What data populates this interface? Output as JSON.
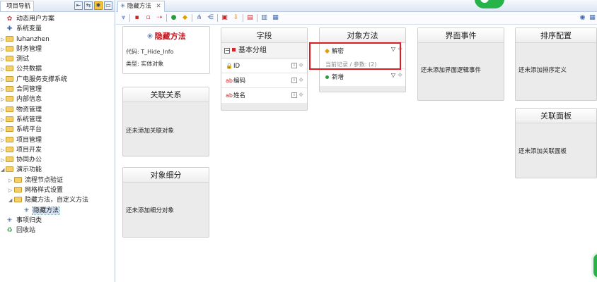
{
  "nav": {
    "tab_label": "项目导航",
    "items": [
      {
        "label": "动态用户方案",
        "icon": "special",
        "level": 0
      },
      {
        "label": "系统变量",
        "icon": "special",
        "level": 0
      },
      {
        "label": "luhanzhen",
        "icon": "folder",
        "level": 0
      },
      {
        "label": "财务管理",
        "icon": "folder",
        "level": 0
      },
      {
        "label": "测试",
        "icon": "folder",
        "level": 0
      },
      {
        "label": "公共数据",
        "icon": "folder",
        "level": 0
      },
      {
        "label": "广电服务支撑系统",
        "icon": "folder",
        "level": 0
      },
      {
        "label": "合同管理",
        "icon": "folder",
        "level": 0
      },
      {
        "label": "内部信息",
        "icon": "folder",
        "level": 0
      },
      {
        "label": "物资管理",
        "icon": "folder",
        "level": 0
      },
      {
        "label": "系统管理",
        "icon": "folder",
        "level": 0
      },
      {
        "label": "系统平台",
        "icon": "folder",
        "level": 0
      },
      {
        "label": "项目管理",
        "icon": "folder",
        "level": 0
      },
      {
        "label": "项目开发",
        "icon": "folder",
        "level": 0
      },
      {
        "label": "协同办公",
        "icon": "folder",
        "level": 0
      },
      {
        "label": "演示功能",
        "icon": "folder",
        "level": 0
      },
      {
        "label": "流程节点验证",
        "icon": "folder",
        "level": 1
      },
      {
        "label": "网格样式设置",
        "icon": "folder",
        "level": 1
      },
      {
        "label": "隐藏方法，自定义方法",
        "icon": "folder",
        "level": 1
      },
      {
        "label": "隐藏方法",
        "icon": "special",
        "level": 2
      },
      {
        "label": "事项归类",
        "icon": "special",
        "level": 0
      },
      {
        "label": "回收站",
        "icon": "special",
        "level": 0
      }
    ]
  },
  "editor": {
    "tab_label": "隐藏方法",
    "info": {
      "title": "隐藏方法",
      "code": "代码: T_Hide_Info",
      "type": "类型: 实体对象"
    },
    "related": {
      "title": "关联关系",
      "empty": "还未添加关联对象"
    },
    "subdivision": {
      "title": "对象细分",
      "empty": "还未添加细分对象"
    },
    "fields": {
      "title": "字段",
      "group": "基本分组",
      "rows": [
        "ID",
        "编码",
        "姓名"
      ]
    },
    "methods": {
      "title": "对象方法",
      "rows": [
        {
          "label": "解密",
          "sub": "当前记录 / 参数: (2)"
        },
        {
          "label": "新增",
          "sub": ""
        }
      ]
    },
    "ui_events": {
      "title": "界面事件",
      "empty": "还未添加界面逻辑事件"
    },
    "sort_config": {
      "title": "排序配置",
      "empty": "还未添加排序定义"
    },
    "related_panel": {
      "title": "关联面板",
      "empty": "还未添加关联面板"
    }
  },
  "colors": {
    "accent_red": "#c0141c",
    "highlight_red": "#e01b24",
    "green": "#26b34a"
  }
}
